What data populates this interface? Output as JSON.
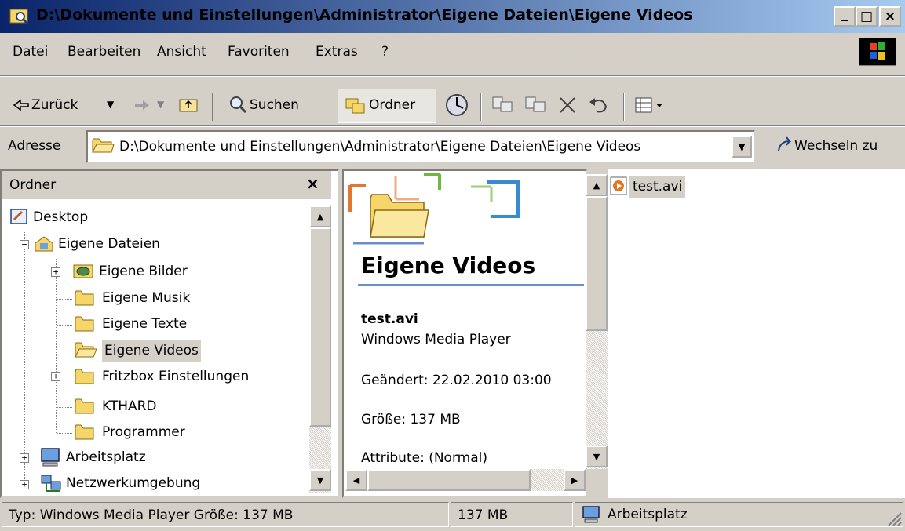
{
  "window": {
    "title": "D:\\Dokumente und Einstellungen\\Administrator\\Eigene Dateien\\Eigene Videos",
    "controls": [
      "_",
      "□",
      "×"
    ]
  },
  "menu": [
    "Datei",
    "Bearbeiten",
    "Ansicht",
    "Favoriten",
    "Extras",
    "?"
  ],
  "toolbar": {
    "back_label": "Zurück",
    "search_label": "Suchen",
    "folders_label": "Ordner"
  },
  "address": {
    "label": "Adresse",
    "value": "D:\\Dokumente und Einstellungen\\Administrator\\Eigene Dateien\\Eigene Videos",
    "go_label": "Wechseln zu"
  },
  "folder_pane": {
    "title": "Ordner",
    "close": "×",
    "tree": [
      {
        "label": "Desktop",
        "icon": "desktop-icon"
      },
      {
        "label": "Eigene Dateien",
        "icon": "my-documents-icon",
        "expanded": true
      },
      {
        "label": "Eigene Bilder",
        "icon": "my-pictures-icon",
        "expandable": true
      },
      {
        "label": "Eigene Musik",
        "icon": "folder-icon"
      },
      {
        "label": "Eigene Texte",
        "icon": "folder-icon"
      },
      {
        "label": "Eigene Videos",
        "icon": "folder-open-icon",
        "selected": true
      },
      {
        "label": "Fritzbox Einstellungen",
        "icon": "folder-icon",
        "expandable": true
      },
      {
        "label": "KTHARD",
        "icon": "folder-icon"
      },
      {
        "label": "Programmer",
        "icon": "folder-icon"
      },
      {
        "label": "Arbeitsplatz",
        "icon": "my-computer-icon",
        "expandable": true
      },
      {
        "label": "Netzwerkumgebung",
        "icon": "network-icon",
        "expandable": true
      }
    ]
  },
  "details_panel": {
    "folder_title": "Eigene Videos",
    "file_name": "test.avi",
    "file_type": "Windows Media Player",
    "modified": "Geändert: 22.02.2010 03:00",
    "size": "Größe: 137 MB",
    "attributes": "Attribute: (Normal)"
  },
  "files": [
    {
      "name": "test.avi",
      "icon": "media-file-icon"
    }
  ],
  "status": {
    "info": "Typ: Windows Media Player Größe: 137 MB",
    "size": "137 MB",
    "zone": "Arbeitsplatz"
  },
  "colors": {
    "title_start": "#0a246a",
    "title_end": "#a6caf0",
    "face": "#d4d0c8",
    "accent_line": "#6a8fce"
  }
}
